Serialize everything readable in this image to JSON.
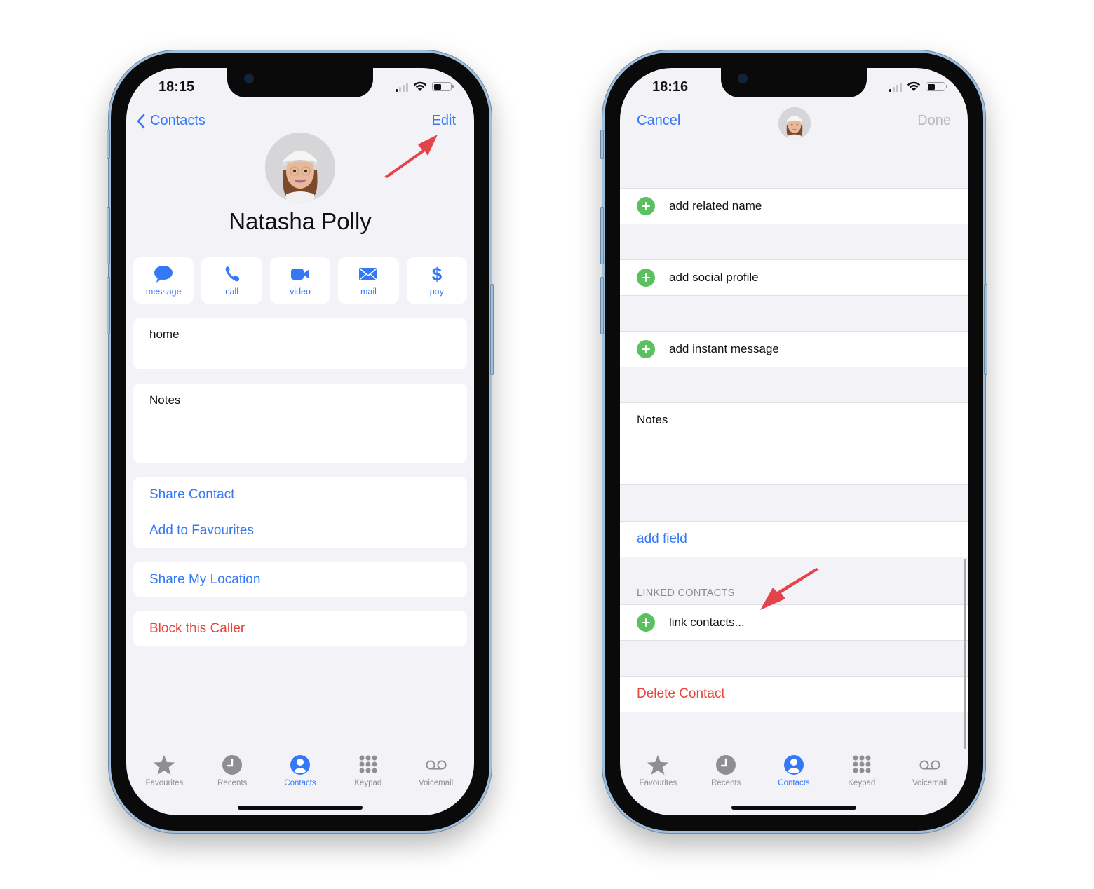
{
  "colors": {
    "accent": "#3478f6",
    "destructive": "#e5453a",
    "add_green": "#5bc160",
    "annotation_arrow": "#e5434a",
    "disabled": "#b9b9be",
    "background": "#f2f2f7"
  },
  "left_phone": {
    "status": {
      "time": "18:15",
      "icons": [
        "cellular-signal-icon",
        "wifi-icon",
        "battery-icon"
      ]
    },
    "nav": {
      "back_label": "Contacts",
      "edit_label": "Edit"
    },
    "contact": {
      "name": "Natasha Polly",
      "avatar": "memoji-avatar"
    },
    "actions": [
      {
        "label": "message",
        "icon": "message-bubble-icon"
      },
      {
        "label": "call",
        "icon": "phone-icon"
      },
      {
        "label": "video",
        "icon": "video-camera-icon"
      },
      {
        "label": "mail",
        "icon": "envelope-icon"
      },
      {
        "label": "pay",
        "icon": "dollar-icon"
      }
    ],
    "fields": {
      "home_label": "home",
      "notes_label": "Notes"
    },
    "menu": {
      "share_contact": "Share Contact",
      "add_to_favourites": "Add to Favourites",
      "share_my_location": "Share My Location",
      "block_caller": "Block this Caller"
    },
    "annotation": "arrow pointing to Edit"
  },
  "right_phone": {
    "status": {
      "time": "18:16",
      "icons": [
        "cellular-signal-icon",
        "wifi-icon",
        "battery-icon"
      ]
    },
    "nav": {
      "cancel_label": "Cancel",
      "done_label": "Done"
    },
    "rows": {
      "add_related_name": "add related name",
      "add_social_profile": "add social profile",
      "add_instant_message": "add instant message",
      "notes_label": "Notes",
      "add_field": "add field",
      "linked_contacts_header": "LINKED CONTACTS",
      "link_contacts": "link contacts...",
      "delete_contact": "Delete Contact"
    },
    "annotation": "arrow pointing to link contacts..."
  },
  "tabbar": {
    "tabs": [
      {
        "label": "Favourites",
        "icon": "star-icon",
        "active": false
      },
      {
        "label": "Recents",
        "icon": "clock-icon",
        "active": false
      },
      {
        "label": "Contacts",
        "icon": "person-circle-icon",
        "active": true
      },
      {
        "label": "Keypad",
        "icon": "keypad-icon",
        "active": false
      },
      {
        "label": "Voicemail",
        "icon": "voicemail-icon",
        "active": false
      }
    ]
  }
}
